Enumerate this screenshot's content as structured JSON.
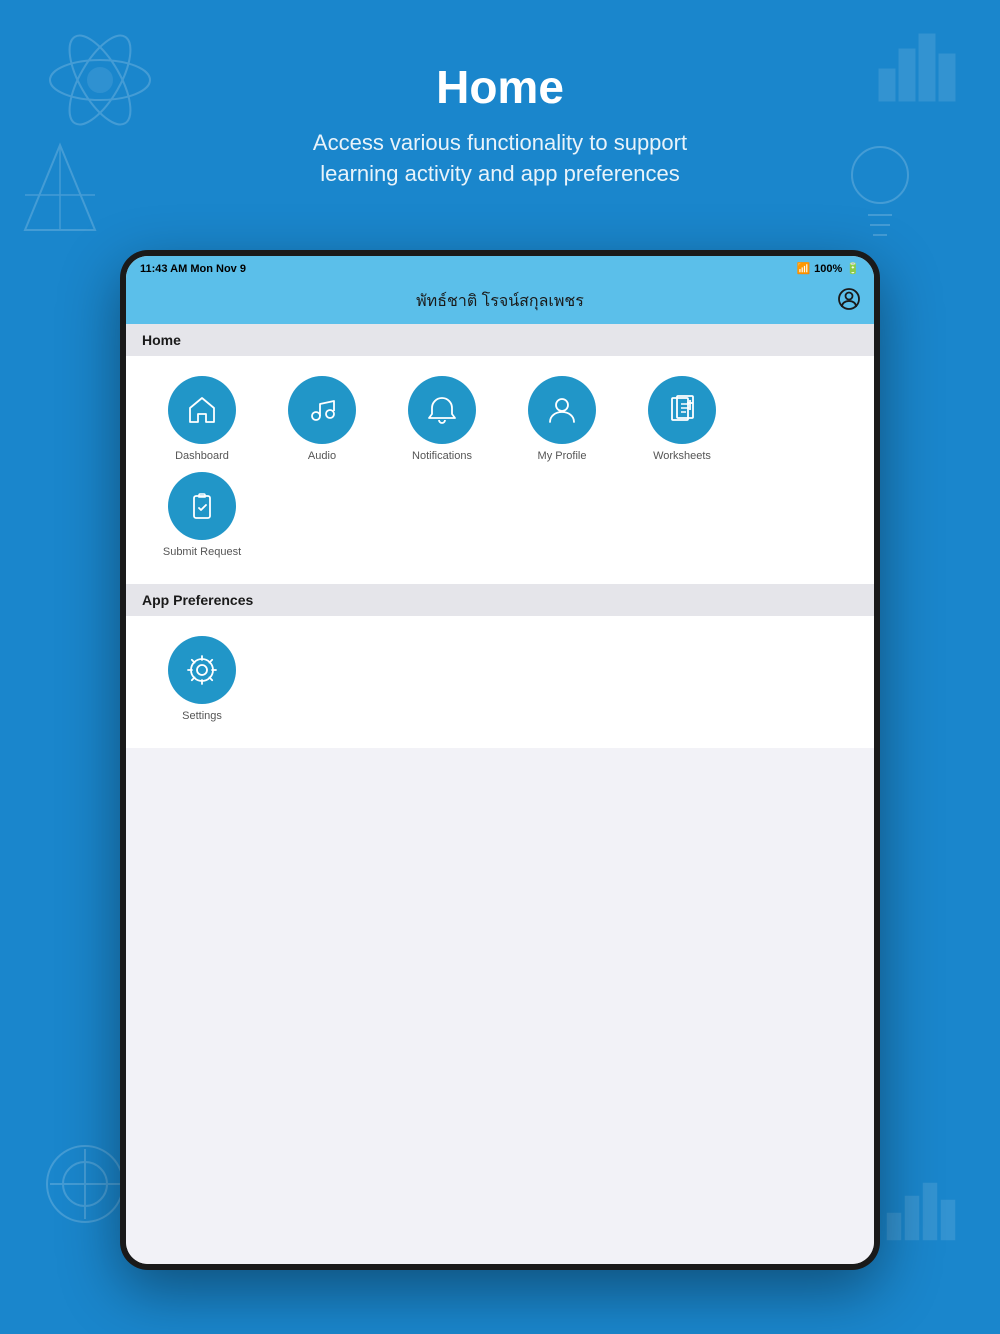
{
  "background_color": "#1a86cc",
  "page_header": {
    "title": "Home",
    "subtitle": "Access various functionality to support\nlearning activity and app preferences"
  },
  "status_bar": {
    "time": "11:43 AM  Mon Nov 9",
    "battery": "100%"
  },
  "nav_bar": {
    "title": "พัทธ์ชาติ โรจน์สกุลเพชร"
  },
  "home_section": {
    "header": "Home",
    "items": [
      {
        "id": "dashboard",
        "label": "Dashboard"
      },
      {
        "id": "audio",
        "label": "Audio"
      },
      {
        "id": "notifications",
        "label": "Notifications"
      },
      {
        "id": "my-profile",
        "label": "My Profile"
      },
      {
        "id": "worksheets",
        "label": "Worksheets"
      },
      {
        "id": "submit-request",
        "label": "Submit Request"
      }
    ]
  },
  "app_preferences_section": {
    "header": "App Preferences",
    "items": [
      {
        "id": "settings",
        "label": "Settings"
      }
    ]
  }
}
